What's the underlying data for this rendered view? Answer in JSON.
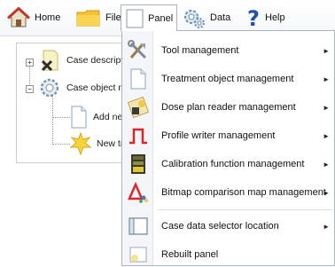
{
  "toolbar": {
    "home": "Home",
    "file": "File",
    "panel": "Panel",
    "data": "Data",
    "help": "Help"
  },
  "tree": {
    "nodes": [
      {
        "label": "Case descriptio",
        "expander": "+"
      },
      {
        "label": "Case object ma",
        "expander": "−"
      },
      {
        "label": "Add new"
      },
      {
        "label": "New tre"
      }
    ]
  },
  "menu": {
    "items": [
      {
        "label": "Tool management",
        "icon": "tools-icon",
        "submenu": true
      },
      {
        "label": "Treatment object management",
        "icon": "document-icon",
        "submenu": true
      },
      {
        "label": "Dose plan reader management",
        "icon": "dose-plan-icon",
        "submenu": true
      },
      {
        "label": "Profile writer management",
        "icon": "profile-pulse-icon",
        "submenu": true
      },
      {
        "label": "Calibration function management",
        "icon": "calibration-film-icon",
        "submenu": true
      },
      {
        "label": "Bitmap comparison map management",
        "icon": "triangle-shapes-icon",
        "submenu": true
      },
      {
        "label": "Case data selector location",
        "icon": "panel-window-icon",
        "submenu": true
      },
      {
        "label": "Rebuilt panel",
        "icon": "rebuild-panel-icon",
        "submenu": false
      }
    ],
    "submenu_arrow": "►"
  }
}
